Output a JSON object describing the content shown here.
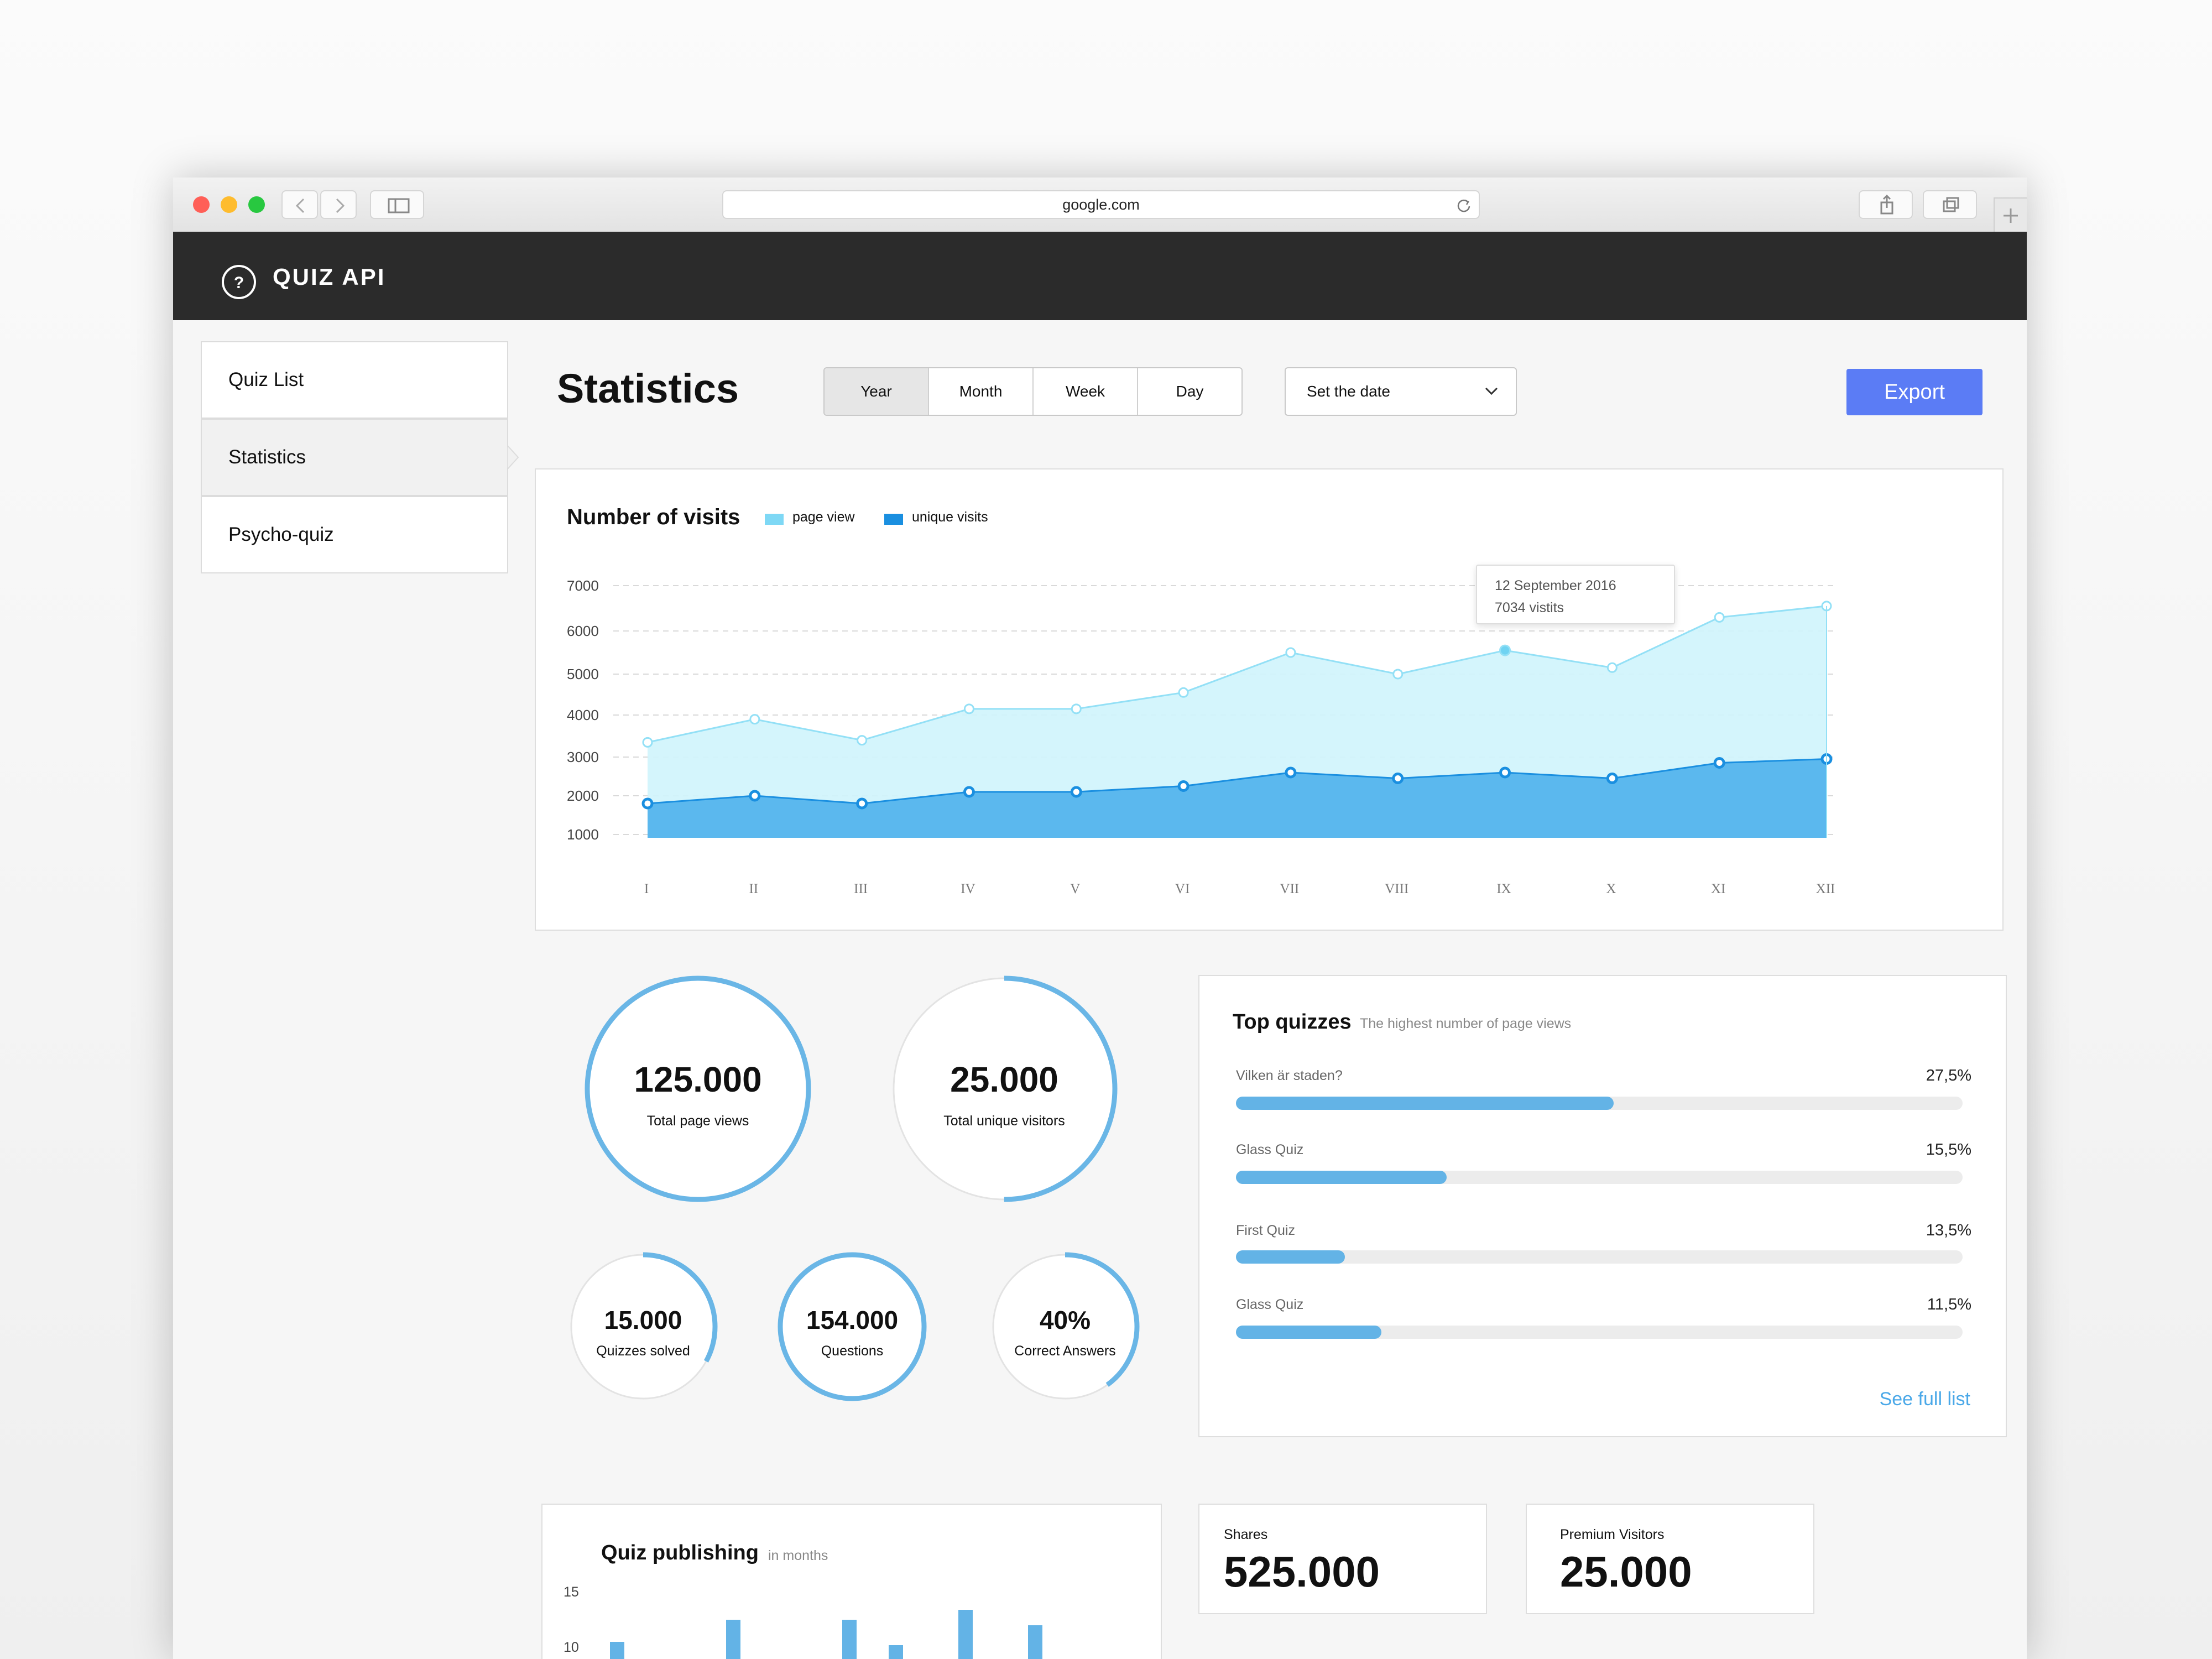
{
  "browser": {
    "url": "google.com",
    "colors": {
      "close": "#ff5f57",
      "minimize": "#febc2e",
      "maximize": "#28c840"
    }
  },
  "app": {
    "title": "QUIZ API"
  },
  "sidebar": {
    "items": [
      {
        "label": "Quiz List"
      },
      {
        "label": "Statistics",
        "active": true
      },
      {
        "label": "Psycho-quiz"
      }
    ]
  },
  "header": {
    "title": "Statistics",
    "periods": [
      "Year",
      "Month",
      "Week",
      "Day"
    ],
    "selected_period": "Year",
    "date_placeholder": "Set the date",
    "export_label": "Export",
    "accent": "#5b7cf5"
  },
  "visits": {
    "title": "Number of visits",
    "legend": [
      {
        "label": "page view",
        "color": "#7ed8f5"
      },
      {
        "label": "unique visits",
        "color": "#1a8fe0"
      }
    ],
    "tooltip": {
      "date": "12 September 2016",
      "value": "7034 vistits"
    }
  },
  "chart_data": [
    {
      "type": "area",
      "title": "Number of visits",
      "categories": [
        "I",
        "II",
        "III",
        "IV",
        "V",
        "VI",
        "VII",
        "VIII",
        "IX",
        "X",
        "XI",
        "XII"
      ],
      "y_ticks": [
        1000,
        2000,
        3000,
        4000,
        5000,
        6000,
        7000
      ],
      "ylim": [
        0,
        7000
      ],
      "grid": true,
      "legend": "top",
      "series": [
        {
          "name": "page view",
          "color": "#7ed8f5",
          "values": [
            3350,
            3900,
            3400,
            4150,
            4150,
            4550,
            5500,
            5000,
            5550,
            5150,
            6300,
            6550
          ]
        },
        {
          "name": "unique visits",
          "color": "#1a8fe0",
          "values": [
            1800,
            2000,
            1800,
            2100,
            2100,
            2250,
            2600,
            2450,
            2600,
            2450,
            2850,
            2950
          ]
        }
      ]
    },
    {
      "type": "bar",
      "title": "Quiz publishing",
      "subtitle": "in months",
      "y_ticks": [
        10,
        15
      ],
      "values": [
        10.5,
        0,
        0,
        0,
        0,
        12.5,
        0,
        0,
        0,
        0,
        12.5,
        0,
        10.2,
        0,
        0,
        13.4,
        0,
        0,
        12
      ]
    }
  ],
  "circles": [
    {
      "value": "125.000",
      "label": "Total page views",
      "fraction": 1.0
    },
    {
      "value": "25.000",
      "label": "Total unique visitors",
      "fraction": 0.5
    },
    {
      "value": "15.000",
      "label": "Quizzes solved",
      "fraction": 0.33
    },
    {
      "value": "154.000",
      "label": "Questions",
      "fraction": 1.0
    },
    {
      "value": "40%",
      "label": "Correct Answers",
      "fraction": 0.4
    }
  ],
  "top_quizzes": {
    "title": "Top quizzes",
    "subtitle": "The highest number of page views",
    "items": [
      {
        "name": "Vilken är staden?",
        "pct": "27,5%",
        "fraction": 0.52
      },
      {
        "name": "Glass Quiz",
        "pct": "15,5%",
        "fraction": 0.29
      },
      {
        "name": "First Quiz",
        "pct": "13,5%",
        "fraction": 0.15
      },
      {
        "name": "Glass Quiz",
        "pct": "11,5%",
        "fraction": 0.2
      }
    ],
    "see_full": "See full list"
  },
  "publishing": {
    "title": "Quiz publishing",
    "subtitle": "in months",
    "y_tick_labels": [
      "15",
      "10"
    ]
  },
  "shares": {
    "label": "Shares",
    "value": "525.000"
  },
  "premium": {
    "label": "Premium Visitors",
    "value": "25.000"
  }
}
